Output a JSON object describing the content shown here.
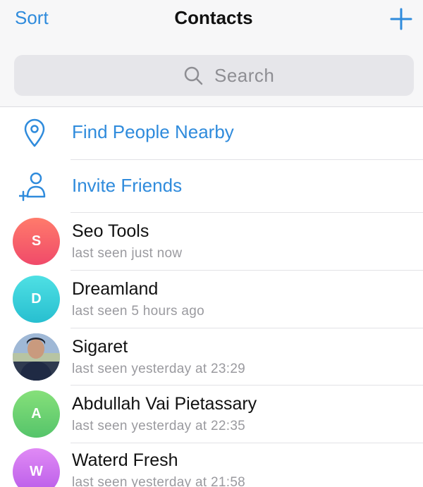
{
  "header": {
    "sort_label": "Sort",
    "title": "Contacts",
    "add_icon": "plus-icon"
  },
  "search": {
    "placeholder": "Search",
    "icon": "search-icon"
  },
  "actions": [
    {
      "label": "Find People Nearby",
      "icon": "location-pin-icon"
    },
    {
      "label": "Invite Friends",
      "icon": "add-person-icon"
    }
  ],
  "contacts": [
    {
      "initial": "S",
      "name": "Seo Tools",
      "status": "last seen just now",
      "avatar_color": "#f25c67"
    },
    {
      "initial": "D",
      "name": "Dreamland",
      "status": "last seen 5 hours ago",
      "avatar_color": "#33cfd8"
    },
    {
      "initial": "",
      "name": "Sigaret",
      "status": "last seen yesterday at 23:29",
      "avatar_color": "#6f8fb3"
    },
    {
      "initial": "A",
      "name": "Abdullah Vai Pietassary",
      "status": "last seen yesterday at 22:35",
      "avatar_color": "#6dd26e"
    },
    {
      "initial": "W",
      "name": "Waterd Fresh",
      "status": "last seen yesterday at 21:58",
      "avatar_color": "#c96cf0"
    }
  ],
  "colors": {
    "accent": "#2f8bdc",
    "header_bg": "#f7f7f8",
    "search_bg": "#e6e6ea"
  }
}
